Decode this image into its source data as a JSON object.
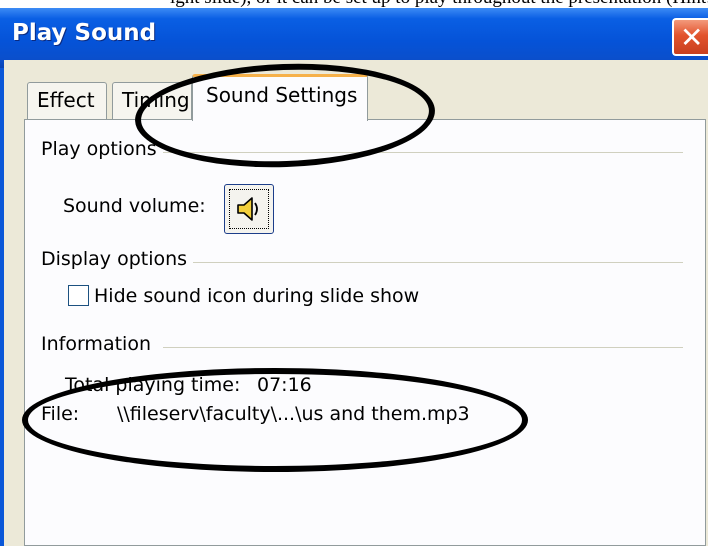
{
  "page_fragment": "ight slide), or it can be set up to play throughout the presentation (Hint: go to",
  "dialog": {
    "title": "Play Sound",
    "close_symbol": "✕"
  },
  "tabs": [
    {
      "label": "Effect",
      "active": false
    },
    {
      "label": "Timing",
      "active": false
    },
    {
      "label": "Sound Settings",
      "active": true
    }
  ],
  "play_options": {
    "heading": "Play options",
    "volume_label": "Sound volume:",
    "volume_icon": "speaker-icon"
  },
  "display_options": {
    "heading": "Display options",
    "hide_icon_label": "Hide sound icon during slide show",
    "hide_icon_checked": false
  },
  "information": {
    "heading": "Information",
    "total_time_label": "Total playing time:",
    "total_time_value": "07:16",
    "file_label": "File:",
    "file_value": "\\\\fileserv\\faculty\\...\\us and them.mp3"
  },
  "colors": {
    "titlebar": "#0553d8",
    "tab_highlight": "#f6b14a",
    "annotation": "#000000"
  }
}
